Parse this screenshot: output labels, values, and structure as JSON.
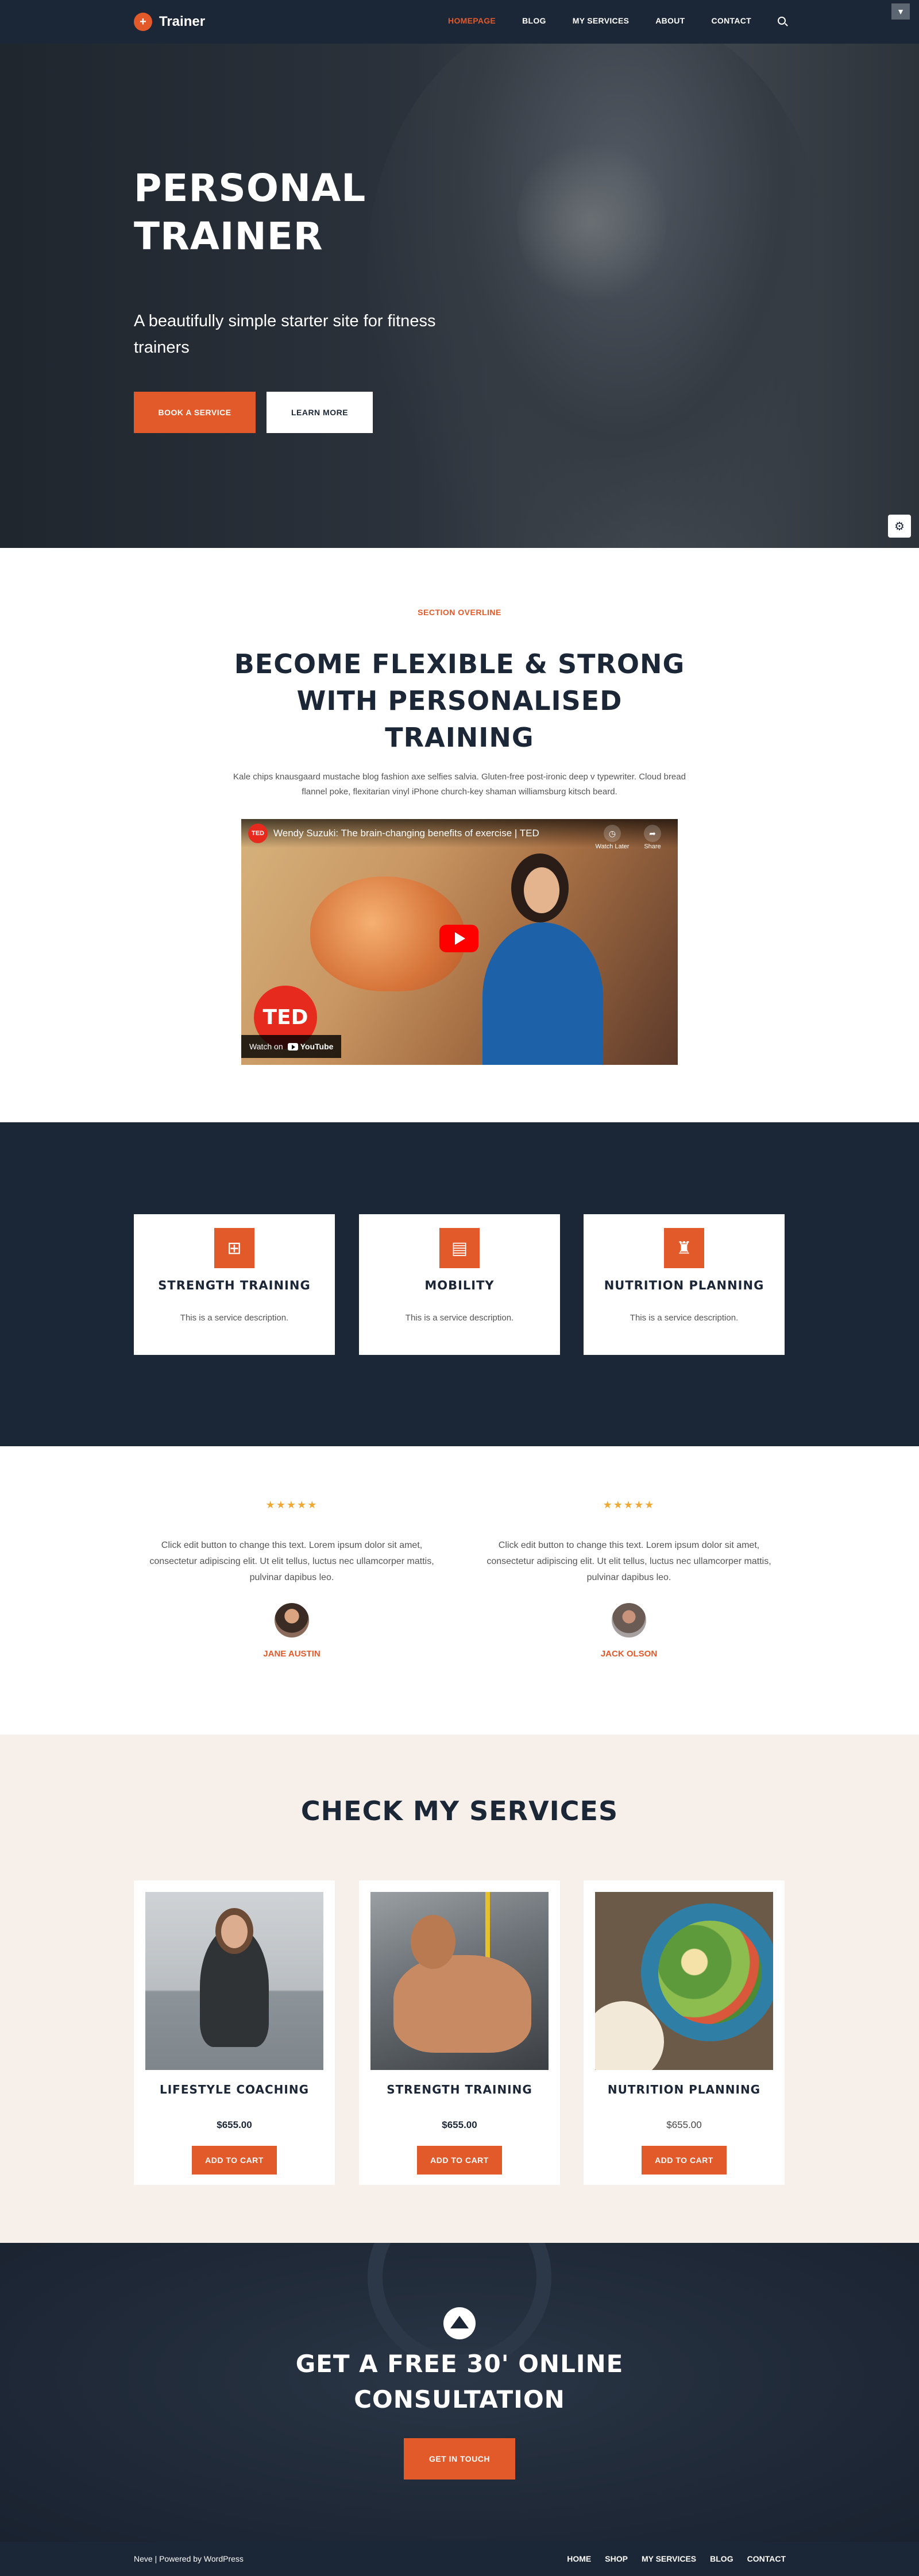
{
  "header": {
    "logo_mark": "+",
    "logo_text": "Trainer",
    "nav": [
      "HOMEPAGE",
      "BLOG",
      "MY SERVICES",
      "ABOUT",
      "CONTACT"
    ],
    "active_index": 0
  },
  "hero": {
    "title": "PERSONAL TRAINER",
    "subtitle": "A beautifully simple starter site for fitness trainers",
    "btn_primary": "BOOK A SERVICE",
    "btn_secondary": "LEARN MORE"
  },
  "intro": {
    "overline": "SECTION OVERLINE",
    "title": "BECOME FLEXIBLE & STRONG WITH PERSONALISED TRAINING",
    "text": "Kale chips knausgaard mustache blog fashion axe selfies salvia. Gluten-free post-ironic deep v typewriter. Cloud bread flannel poke, flexitarian vinyl iPhone church-key shaman williamsburg kitsch beard.",
    "video": {
      "channel_badge": "TED",
      "title": "Wendy Suzuki: The brain-changing benefits of exercise | TED",
      "watch_later": "Watch Later",
      "share": "Share",
      "ted_logo": "TED",
      "watch_on": "Watch on",
      "youtube": "YouTube"
    }
  },
  "services": [
    {
      "icon": "dumbbell-icon",
      "title": "STRENGTH TRAINING",
      "desc": "This is a service description."
    },
    {
      "icon": "document-icon",
      "title": "MOBILITY",
      "desc": "This is a service description."
    },
    {
      "icon": "trophy-icon",
      "title": "NUTRITION PLANNING",
      "desc": "This is a service description."
    }
  ],
  "testimonials": [
    {
      "stars": "★★★★★",
      "rating": 5,
      "text": "Click edit button to change this text. Lorem ipsum dolor sit amet, consectetur adipiscing elit. Ut elit tellus, luctus nec ullamcorper mattis, pulvinar dapibus leo.",
      "name": "JANE AUSTIN"
    },
    {
      "stars": "★★★★★",
      "rating": 5,
      "text": "Click edit button to change this text. Lorem ipsum dolor sit amet, consectetur adipiscing elit. Ut elit tellus, luctus nec ullamcorper mattis, pulvinar dapibus leo.",
      "name": "JACK OLSON"
    }
  ],
  "shop": {
    "title": "CHECK MY SERVICES",
    "products": [
      {
        "name": "LIFESTYLE COACHING",
        "price": "$655.00",
        "button": "ADD TO CART"
      },
      {
        "name": "STRENGTH TRAINING",
        "price": "$655.00",
        "button": "ADD TO CART"
      },
      {
        "name": "NUTRITION PLANNING",
        "price": "$655.00",
        "button": "ADD TO CART"
      }
    ]
  },
  "cta": {
    "title": "GET A FREE 30' ONLINE CONSULTATION",
    "button": "GET IN TOUCH"
  },
  "footer": {
    "credit": "Neve | Powered by WordPress",
    "nav": [
      "HOME",
      "SHOP",
      "MY SERVICES",
      "BLOG",
      "CONTACT"
    ]
  },
  "colors": {
    "accent": "#e2592a",
    "navy": "#1b2637",
    "cream": "#f7efe9",
    "star": "#f0a935"
  }
}
